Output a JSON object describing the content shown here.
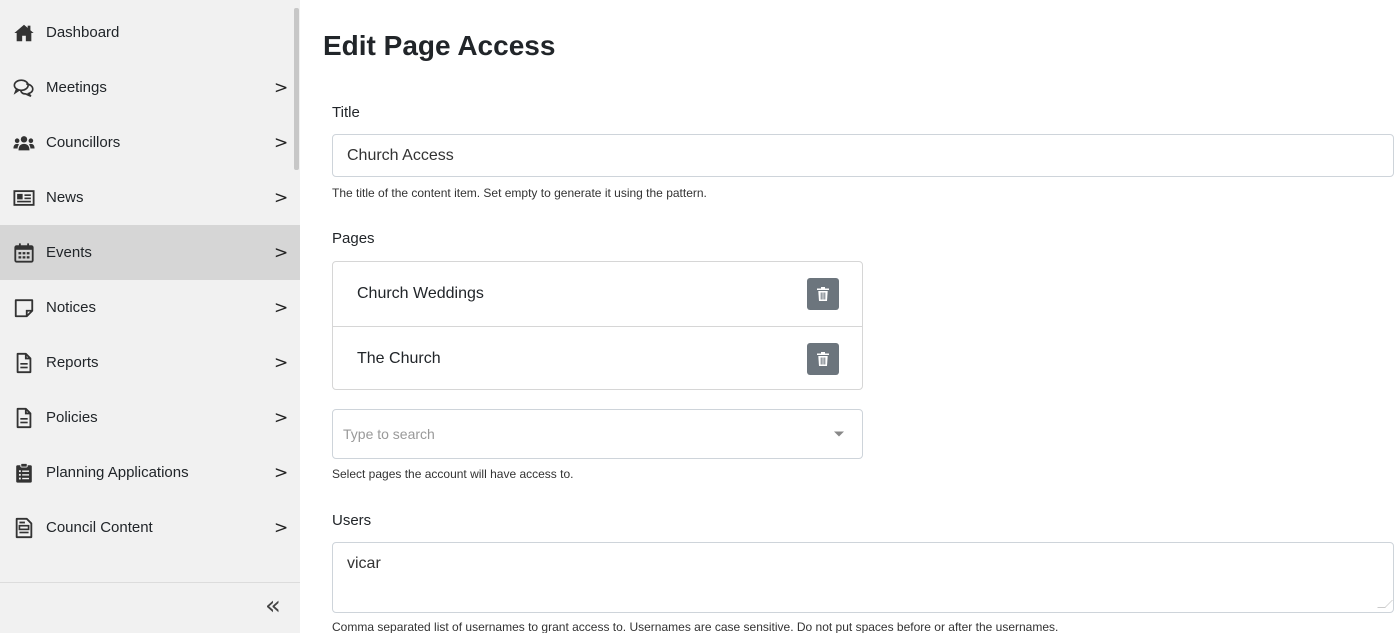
{
  "sidebar": {
    "items": [
      {
        "label": "Dashboard",
        "icon": "home-icon",
        "has_chevron": false,
        "active": false
      },
      {
        "label": "Meetings",
        "icon": "comments-icon",
        "has_chevron": true,
        "active": false
      },
      {
        "label": "Councillors",
        "icon": "users-icon",
        "has_chevron": true,
        "active": false
      },
      {
        "label": "News",
        "icon": "newspaper-icon",
        "has_chevron": true,
        "active": false
      },
      {
        "label": "Events",
        "icon": "calendar-icon",
        "has_chevron": true,
        "active": true
      },
      {
        "label": "Notices",
        "icon": "sticky-note-icon",
        "has_chevron": true,
        "active": false
      },
      {
        "label": "Reports",
        "icon": "file-text-icon",
        "has_chevron": true,
        "active": false
      },
      {
        "label": "Policies",
        "icon": "file-text-icon",
        "has_chevron": true,
        "active": false
      },
      {
        "label": "Planning Applications",
        "icon": "clipboard-list-icon",
        "has_chevron": true,
        "active": false
      },
      {
        "label": "Council Content",
        "icon": "file-list-icon",
        "has_chevron": true,
        "active": false
      }
    ],
    "chevron": ">",
    "collapse_glyph": "«"
  },
  "form": {
    "page_title": "Edit Page Access",
    "title_label": "Title",
    "title_value": "Church Access",
    "title_help": "The title of the content item. Set empty to generate it using the pattern.",
    "pages_label": "Pages",
    "pages": [
      {
        "name": "Church Weddings"
      },
      {
        "name": "The Church"
      }
    ],
    "search_placeholder": "Type to search",
    "pages_help": "Select pages the account will have access to.",
    "users_label": "Users",
    "users_value": "vicar",
    "users_help": "Comma separated list of usernames to grant access to. Usernames are case sensitive. Do not put spaces before or after the usernames."
  },
  "colors": {
    "sidebar_bg": "#f1f1f1",
    "sidebar_active_bg": "#d6d6d6",
    "trash_button_bg": "#6c757d",
    "input_border": "#ced4da"
  }
}
